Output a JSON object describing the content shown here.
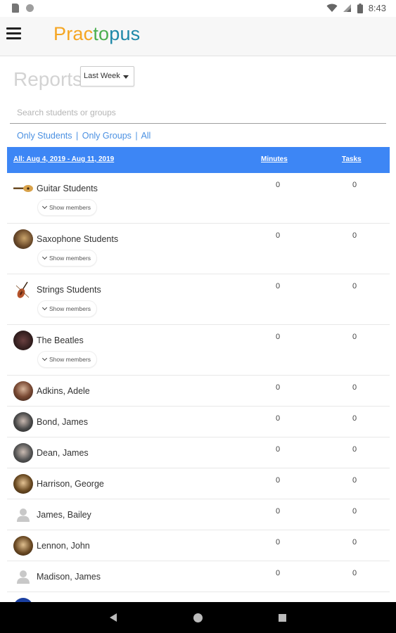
{
  "status_bar": {
    "time": "8:43"
  },
  "app_bar": {
    "logo_part1": "Prac",
    "logo_part2": "to",
    "logo_part3": "pus"
  },
  "page": {
    "title": "Reports",
    "period_selected": "Last Week",
    "search_placeholder": "Search students or groups",
    "filters": {
      "students": "Only Students",
      "groups": "Only Groups",
      "all": "All",
      "separator": "|"
    }
  },
  "table": {
    "header": {
      "range": "All: Aug 4, 2019 - Aug 11, 2019",
      "minutes": "Minutes",
      "tasks": "Tasks"
    },
    "show_members_label": "Show members",
    "groups": [
      {
        "name": "Guitar Students",
        "minutes": "0",
        "tasks": "0",
        "avatar": "guitar-icon"
      },
      {
        "name": "Saxophone Students",
        "minutes": "0",
        "tasks": "0",
        "avatar": "saxophone-photo"
      },
      {
        "name": "Strings Students",
        "minutes": "0",
        "tasks": "0",
        "avatar": "violin-icon"
      },
      {
        "name": "The Beatles",
        "minutes": "0",
        "tasks": "0",
        "avatar": "band-photo"
      }
    ],
    "students": [
      {
        "name": "Adkins, Adele",
        "minutes": "0",
        "tasks": "0",
        "avatar": "profile-photo"
      },
      {
        "name": "Bond, James",
        "minutes": "0",
        "tasks": "0",
        "avatar": "profile-photo"
      },
      {
        "name": "Dean, James",
        "minutes": "0",
        "tasks": "0",
        "avatar": "profile-photo"
      },
      {
        "name": "Harrison, George",
        "minutes": "0",
        "tasks": "0",
        "avatar": "profile-photo"
      },
      {
        "name": "James, Bailey",
        "minutes": "0",
        "tasks": "0",
        "avatar": "person-placeholder-icon"
      },
      {
        "name": "Lennon, John",
        "minutes": "0",
        "tasks": "0",
        "avatar": "profile-photo"
      },
      {
        "name": "Madison, James",
        "minutes": "0",
        "tasks": "0",
        "avatar": "person-placeholder-icon"
      }
    ]
  },
  "colors": {
    "header_blue": "#3d86f5",
    "link_blue": "#4a90e2",
    "logo_orange": "#f5a623",
    "logo_green": "#4caf50",
    "logo_teal": "#1e88a8"
  }
}
